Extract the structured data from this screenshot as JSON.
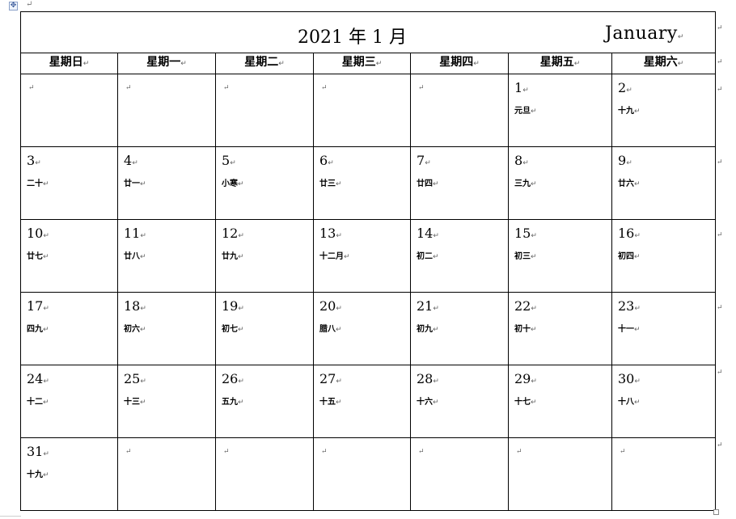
{
  "title": {
    "year_month": "2021 年 1 月",
    "english_month": "January"
  },
  "paragraph_mark": "↵",
  "weekdays": [
    "星期日",
    "星期一",
    "星期二",
    "星期三",
    "星期四",
    "星期五",
    "星期六"
  ],
  "weeks": [
    [
      {
        "day": "",
        "lunar": ""
      },
      {
        "day": "",
        "lunar": ""
      },
      {
        "day": "",
        "lunar": ""
      },
      {
        "day": "",
        "lunar": ""
      },
      {
        "day": "",
        "lunar": ""
      },
      {
        "day": "1",
        "lunar": "元旦"
      },
      {
        "day": "2",
        "lunar": "十九"
      }
    ],
    [
      {
        "day": "3",
        "lunar": "二十"
      },
      {
        "day": "4",
        "lunar": "廿一"
      },
      {
        "day": "5",
        "lunar": "小寒"
      },
      {
        "day": "6",
        "lunar": "廿三"
      },
      {
        "day": "7",
        "lunar": "廿四"
      },
      {
        "day": "8",
        "lunar": "三九"
      },
      {
        "day": "9",
        "lunar": "廿六"
      }
    ],
    [
      {
        "day": "10",
        "lunar": "廿七"
      },
      {
        "day": "11",
        "lunar": "廿八"
      },
      {
        "day": "12",
        "lunar": "廿九"
      },
      {
        "day": "13",
        "lunar": "十二月"
      },
      {
        "day": "14",
        "lunar": "初二"
      },
      {
        "day": "15",
        "lunar": "初三"
      },
      {
        "day": "16",
        "lunar": "初四"
      }
    ],
    [
      {
        "day": "17",
        "lunar": "四九"
      },
      {
        "day": "18",
        "lunar": "初六"
      },
      {
        "day": "19",
        "lunar": "初七"
      },
      {
        "day": "20",
        "lunar": "腊八"
      },
      {
        "day": "21",
        "lunar": "初九"
      },
      {
        "day": "22",
        "lunar": "初十"
      },
      {
        "day": "23",
        "lunar": "十一"
      }
    ],
    [
      {
        "day": "24",
        "lunar": "十二"
      },
      {
        "day": "25",
        "lunar": "十三"
      },
      {
        "day": "26",
        "lunar": "五九"
      },
      {
        "day": "27",
        "lunar": "十五"
      },
      {
        "day": "28",
        "lunar": "十六"
      },
      {
        "day": "29",
        "lunar": "十七"
      },
      {
        "day": "30",
        "lunar": "十八"
      }
    ],
    [
      {
        "day": "31",
        "lunar": "十九"
      },
      {
        "day": "",
        "lunar": ""
      },
      {
        "day": "",
        "lunar": ""
      },
      {
        "day": "",
        "lunar": ""
      },
      {
        "day": "",
        "lunar": ""
      },
      {
        "day": "",
        "lunar": ""
      },
      {
        "day": "",
        "lunar": ""
      }
    ]
  ]
}
